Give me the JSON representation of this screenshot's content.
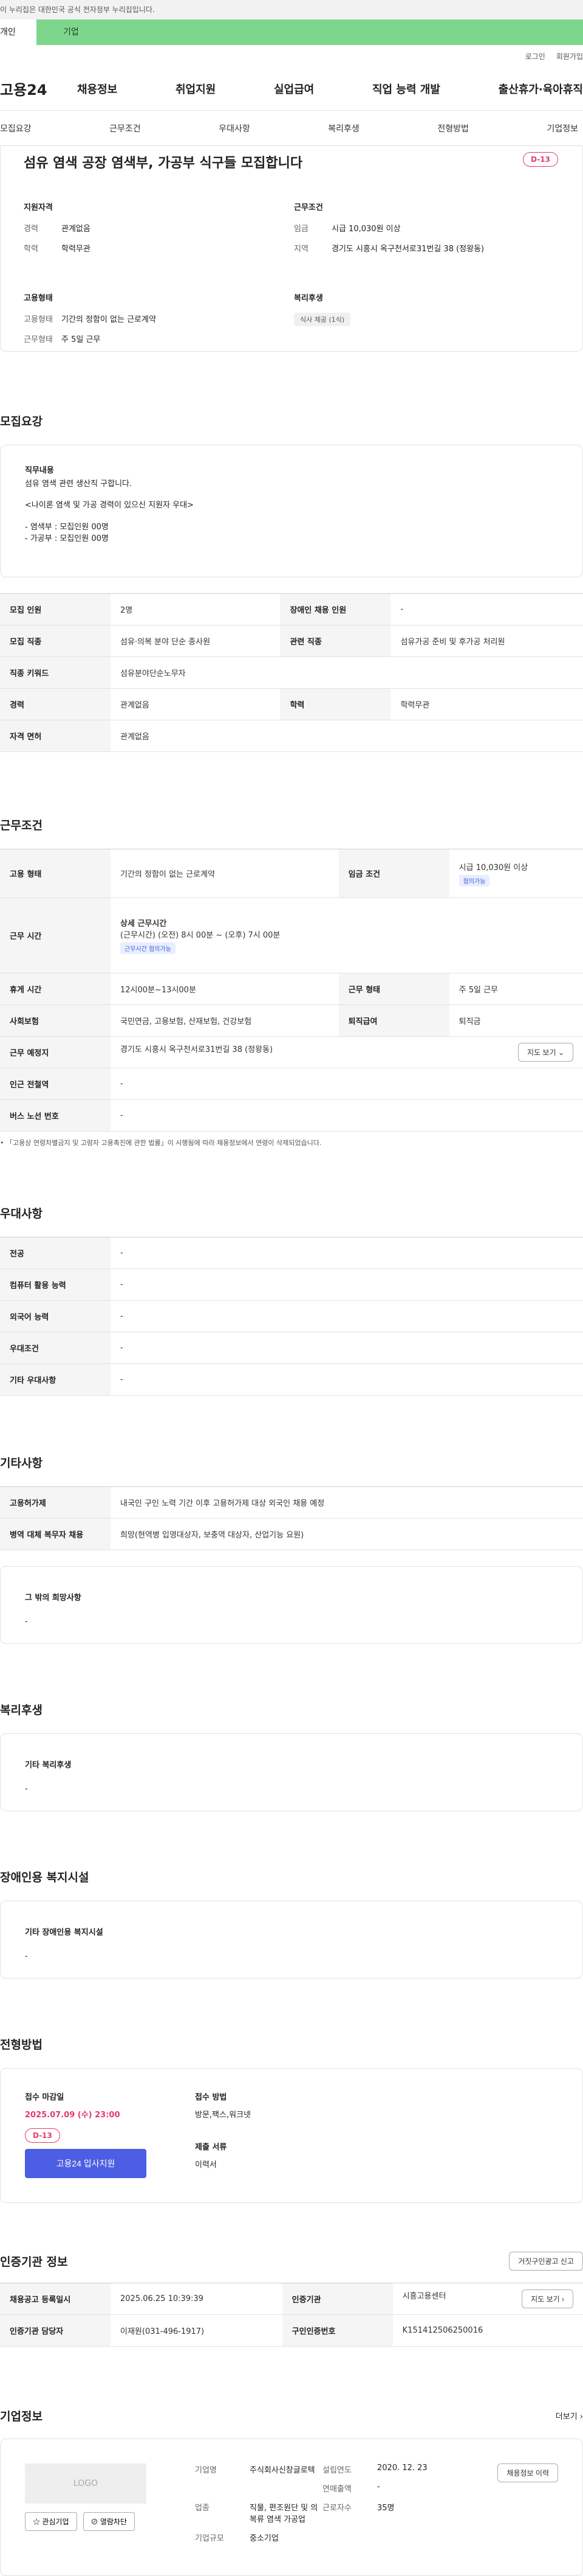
{
  "notice": "이 누리집은 대한민국 공식 전자정부 누리집입니다.",
  "top_tabs": {
    "personal": "개인",
    "corp": "기업"
  },
  "util": {
    "login": "로그인",
    "join": "회원가입"
  },
  "gnb": {
    "logo": "고용24",
    "menu": [
      "채용정보",
      "취업지원",
      "실업급여",
      "직업 능력 개발",
      "출산휴가·육아휴직"
    ]
  },
  "subnav": [
    "모집요강",
    "근무조건",
    "우대사항",
    "복리후생",
    "전형방법",
    "기업정보"
  ],
  "summary": {
    "title": "섬유 염색 공장 염색부, 가공부 식구들 모집합니다",
    "dday": "D-13",
    "qual_title": "지원자격",
    "career_k": "경력",
    "career_v": "관계없음",
    "edu_k": "학력",
    "edu_v": "학력무관",
    "cond_title": "근무조건",
    "wage_k": "임금",
    "wage_v": "시급 10,030원 이상",
    "region_k": "지역",
    "region_v": "경기도 시흥시 옥구천서로31번길 38 (정왕동)",
    "emp_title": "고용형태",
    "emptype_k": "고용형태",
    "emptype_v": "기간의 정함이 없는 근로계약",
    "workform_k": "근무형태",
    "workform_v": "주 5일 근무",
    "welfare_title": "복리후생",
    "welfare_chip": "식사 제공 (1식)"
  },
  "recruit": {
    "section": "모집요강",
    "duty_title": "직무내용",
    "duty_lines": [
      "섬유 염색 관련 생산직 구합니다.",
      "",
      "<나이론 염색 및 가공 경력이 있으신 지원자 우대>",
      "",
      "- 염색부 : 모집인원 00명",
      "- 가공부 : 모집인원 00명"
    ],
    "rows": [
      {
        "k1": "모집 인원",
        "v1": "2명",
        "k2": "장애인 채용 인원",
        "v2": "-"
      },
      {
        "k1": "모집 직종",
        "v1": "섬유·의복 분야 단순 종사원",
        "k2": "관련 직종",
        "v2": "섬유가공 준비 및 후가공 처리원"
      },
      {
        "k1": "직종 키워드",
        "v1": "섬유분야단순노무자",
        "k2": "",
        "v2": ""
      },
      {
        "k1": "경력",
        "v1": "관계없음",
        "k2": "학력",
        "v2": "학력무관"
      },
      {
        "k1": "자격 면허",
        "v1": "관계없음",
        "k2": "",
        "v2": ""
      }
    ]
  },
  "conditions": {
    "section": "근무조건",
    "emp_k": "고용 형태",
    "emp_v": "기간의 정함이 없는 근로계약",
    "wage_k": "임금 조건",
    "wage_v": "시급 10,030원 이상",
    "wage_chip": "협의가능",
    "hours_k": "근무 시간",
    "hours_title": "상세 근무시간",
    "hours_v": "(근무시간) (오전) 8시 00분 ~ (오후) 7시 00분",
    "hours_chip": "근무시간 협의가능",
    "break_k": "휴게 시간",
    "break_v": "12시00분~13시00분",
    "form_k": "근무 형태",
    "form_v": "주 5일 근무",
    "ins_k": "사회보험",
    "ins_v": "국민연금, 고용보험, 산재보험, 건강보험",
    "ret_k": "퇴직급여",
    "ret_v": "퇴직금",
    "place_k": "근무 예정지",
    "place_v": "경기도 시흥시 옥구천서로31번길 38 (정왕동)",
    "map_btn": "지도 보기 ⌄",
    "subway_k": "인근 전철역",
    "subway_v": "-",
    "bus_k": "버스 노선 번호",
    "bus_v": "-",
    "note": "「고용상 연령차별금지 및 고령자 고용촉진에 관한 법률」이 시행됨에 따라 채용정보에서 연령이 삭제되었습니다."
  },
  "pref": {
    "section": "우대사항",
    "rows": [
      {
        "k": "전공",
        "v": "-"
      },
      {
        "k": "컴퓨터 활용 능력",
        "v": "-"
      },
      {
        "k": "외국어 능력",
        "v": "-"
      },
      {
        "k": "우대조건",
        "v": "-"
      },
      {
        "k": "기타 우대사항",
        "v": "-"
      }
    ]
  },
  "etc": {
    "section": "기타사항",
    "rows": [
      {
        "k": "고용허가제",
        "v": "내국인 구인 노력 기간 이후 고용허가제 대상 외국인 채용 예정"
      },
      {
        "k": "병역 대체 복무자 채용",
        "v": "희망(현역병 입영대상자, 보충역 대상자, 산업기능 요원)"
      }
    ],
    "hope_title": "그 밖의 희망사항",
    "hope_v": "-"
  },
  "welfare": {
    "section": "복리후생",
    "title": "기타 복리후생",
    "v": "-"
  },
  "disabled": {
    "section": "장애인용 복지시설",
    "title": "기타 장애인용 복지시설",
    "v": "-"
  },
  "screening": {
    "section": "전형방법",
    "deadline_title": "접수 마감일",
    "deadline": "2025.07.09 (수) 23:00",
    "dday": "D-13",
    "apply_btn": "고용24 입사지원",
    "method_title": "접수 방법",
    "method_v": "방문,팩스,워크넷",
    "docs_title": "제출 서류",
    "docs_v": "이력서"
  },
  "cert": {
    "section": "인증기관 정보",
    "report_btn": "거짓구인광고 신고",
    "reg_k": "채용공고 등록일시",
    "reg_v": "2025.06.25 10:39:39",
    "org_k": "인증기관",
    "org_v": "시흥고용센터",
    "map_btn": "지도 보기 ›",
    "mgr_k": "인증기관 담당자",
    "mgr_v": "이재원(031-496-1917)",
    "no_k": "구인인증번호",
    "no_v": "K151412506250016"
  },
  "company": {
    "section": "기업정보",
    "more": "더보기 ›",
    "logo": "LOGO",
    "fav": "☆ 관심기업",
    "block": "⊘ 열람차단",
    "name_k": "기업명",
    "name_v": "주식회사신창글로텍",
    "est_k": "설립연도",
    "est_v": "2020. 12. 23",
    "sales_k": "연매출액",
    "sales_v": "-",
    "biz_k": "업종",
    "biz_v": "직물, 편조원단 및 의복류 염색 가공업",
    "emp_k": "근로자수",
    "emp_v": "35명",
    "size_k": "기업규모",
    "size_v": "중소기업",
    "history_btn": "채용정보 이력"
  }
}
